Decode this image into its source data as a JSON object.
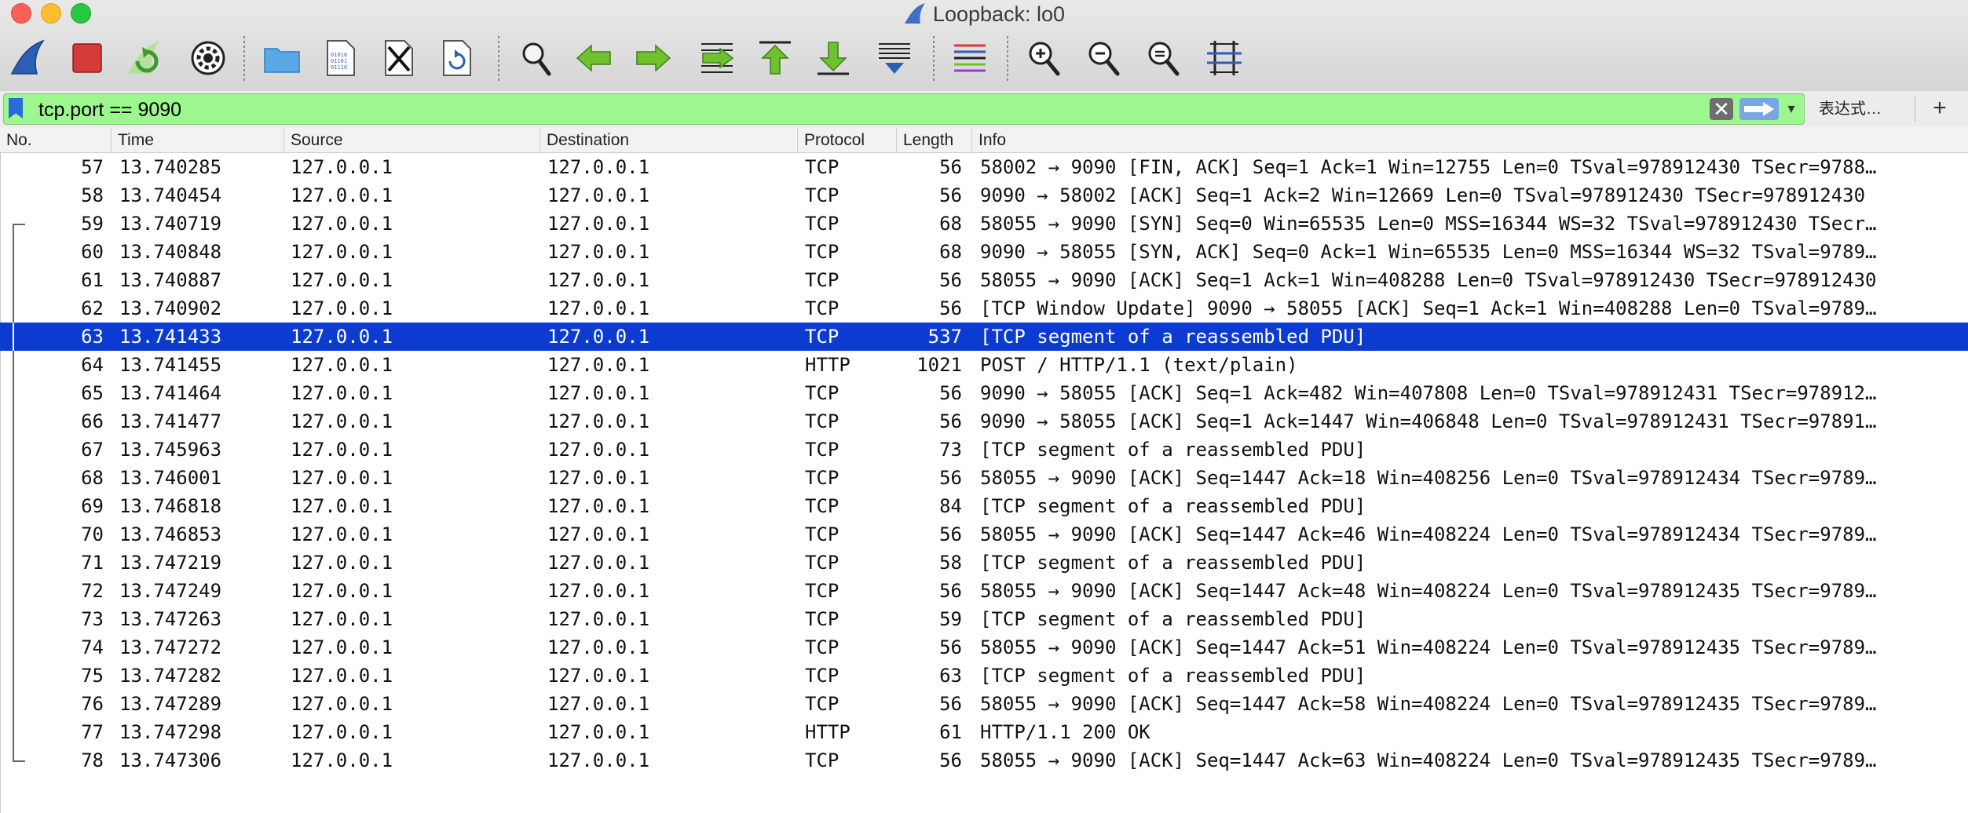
{
  "window": {
    "title": "Loopback: lo0"
  },
  "toolbar": {
    "buttons": [
      {
        "icon": "shark-fin-icon",
        "label": "Start capture"
      },
      {
        "icon": "stop-icon",
        "label": "Stop capture"
      },
      {
        "icon": "restart-icon",
        "label": "Restart capture"
      },
      {
        "icon": "gear-icon",
        "label": "Capture options"
      },
      {
        "icon": "folder-icon",
        "label": "Open"
      },
      {
        "icon": "file-icon",
        "label": "Save"
      },
      {
        "icon": "close-file-icon",
        "label": "Close"
      },
      {
        "icon": "reload-icon",
        "label": "Reload"
      },
      {
        "icon": "search-icon",
        "label": "Find packet"
      },
      {
        "icon": "arrow-left-icon",
        "label": "Previous packet"
      },
      {
        "icon": "arrow-right-icon",
        "label": "Next packet"
      },
      {
        "icon": "goto-icon",
        "label": "Go to packet"
      },
      {
        "icon": "first-packet-icon",
        "label": "First packet"
      },
      {
        "icon": "last-packet-icon",
        "label": "Last packet"
      },
      {
        "icon": "autoscroll-icon",
        "label": "Auto scroll"
      },
      {
        "icon": "colorize-icon",
        "label": "Colorize"
      },
      {
        "icon": "zoom-in-icon",
        "label": "Zoom in"
      },
      {
        "icon": "zoom-out-icon",
        "label": "Zoom out"
      },
      {
        "icon": "zoom-reset-icon",
        "label": "Normal size"
      },
      {
        "icon": "resize-columns-icon",
        "label": "Resize columns"
      }
    ]
  },
  "filter": {
    "value": "tcp.port == 9090",
    "expression_label": "表达式…",
    "add_label": "+"
  },
  "columns": [
    "No.",
    "Time",
    "Source",
    "Destination",
    "Protocol",
    "Length",
    "Info"
  ],
  "packets": [
    {
      "no": "57",
      "time": "13.740285",
      "src": "127.0.0.1",
      "dst": "127.0.0.1",
      "proto": "TCP",
      "len": "56",
      "info": "58002 → 9090 [FIN, ACK] Seq=1 Ack=1 Win=12755 Len=0 TSval=978912430 TSecr=9788…"
    },
    {
      "no": "58",
      "time": "13.740454",
      "src": "127.0.0.1",
      "dst": "127.0.0.1",
      "proto": "TCP",
      "len": "56",
      "info": "9090 → 58002 [ACK] Seq=1 Ack=2 Win=12669 Len=0 TSval=978912430 TSecr=978912430"
    },
    {
      "no": "59",
      "time": "13.740719",
      "src": "127.0.0.1",
      "dst": "127.0.0.1",
      "proto": "TCP",
      "len": "68",
      "info": "58055 → 9090 [SYN] Seq=0 Win=65535 Len=0 MSS=16344 WS=32 TSval=978912430 TSecr…"
    },
    {
      "no": "60",
      "time": "13.740848",
      "src": "127.0.0.1",
      "dst": "127.0.0.1",
      "proto": "TCP",
      "len": "68",
      "info": "9090 → 58055 [SYN, ACK] Seq=0 Ack=1 Win=65535 Len=0 MSS=16344 WS=32 TSval=9789…"
    },
    {
      "no": "61",
      "time": "13.740887",
      "src": "127.0.0.1",
      "dst": "127.0.0.1",
      "proto": "TCP",
      "len": "56",
      "info": "58055 → 9090 [ACK] Seq=1 Ack=1 Win=408288 Len=0 TSval=978912430 TSecr=978912430"
    },
    {
      "no": "62",
      "time": "13.740902",
      "src": "127.0.0.1",
      "dst": "127.0.0.1",
      "proto": "TCP",
      "len": "56",
      "info": "[TCP Window Update] 9090 → 58055 [ACK] Seq=1 Ack=1 Win=408288 Len=0 TSval=9789…"
    },
    {
      "no": "63",
      "time": "13.741433",
      "src": "127.0.0.1",
      "dst": "127.0.0.1",
      "proto": "TCP",
      "len": "537",
      "info": "[TCP segment of a reassembled PDU]",
      "selected": true
    },
    {
      "no": "64",
      "time": "13.741455",
      "src": "127.0.0.1",
      "dst": "127.0.0.1",
      "proto": "HTTP",
      "len": "1021",
      "info": "POST / HTTP/1.1  (text/plain)"
    },
    {
      "no": "65",
      "time": "13.741464",
      "src": "127.0.0.1",
      "dst": "127.0.0.1",
      "proto": "TCP",
      "len": "56",
      "info": "9090 → 58055 [ACK] Seq=1 Ack=482 Win=407808 Len=0 TSval=978912431 TSecr=978912…"
    },
    {
      "no": "66",
      "time": "13.741477",
      "src": "127.0.0.1",
      "dst": "127.0.0.1",
      "proto": "TCP",
      "len": "56",
      "info": "9090 → 58055 [ACK] Seq=1 Ack=1447 Win=406848 Len=0 TSval=978912431 TSecr=97891…"
    },
    {
      "no": "67",
      "time": "13.745963",
      "src": "127.0.0.1",
      "dst": "127.0.0.1",
      "proto": "TCP",
      "len": "73",
      "info": "[TCP segment of a reassembled PDU]"
    },
    {
      "no": "68",
      "time": "13.746001",
      "src": "127.0.0.1",
      "dst": "127.0.0.1",
      "proto": "TCP",
      "len": "56",
      "info": "58055 → 9090 [ACK] Seq=1447 Ack=18 Win=408256 Len=0 TSval=978912434 TSecr=9789…"
    },
    {
      "no": "69",
      "time": "13.746818",
      "src": "127.0.0.1",
      "dst": "127.0.0.1",
      "proto": "TCP",
      "len": "84",
      "info": "[TCP segment of a reassembled PDU]"
    },
    {
      "no": "70",
      "time": "13.746853",
      "src": "127.0.0.1",
      "dst": "127.0.0.1",
      "proto": "TCP",
      "len": "56",
      "info": "58055 → 9090 [ACK] Seq=1447 Ack=46 Win=408224 Len=0 TSval=978912434 TSecr=9789…"
    },
    {
      "no": "71",
      "time": "13.747219",
      "src": "127.0.0.1",
      "dst": "127.0.0.1",
      "proto": "TCP",
      "len": "58",
      "info": "[TCP segment of a reassembled PDU]"
    },
    {
      "no": "72",
      "time": "13.747249",
      "src": "127.0.0.1",
      "dst": "127.0.0.1",
      "proto": "TCP",
      "len": "56",
      "info": "58055 → 9090 [ACK] Seq=1447 Ack=48 Win=408224 Len=0 TSval=978912435 TSecr=9789…"
    },
    {
      "no": "73",
      "time": "13.747263",
      "src": "127.0.0.1",
      "dst": "127.0.0.1",
      "proto": "TCP",
      "len": "59",
      "info": "[TCP segment of a reassembled PDU]"
    },
    {
      "no": "74",
      "time": "13.747272",
      "src": "127.0.0.1",
      "dst": "127.0.0.1",
      "proto": "TCP",
      "len": "56",
      "info": "58055 → 9090 [ACK] Seq=1447 Ack=51 Win=408224 Len=0 TSval=978912435 TSecr=9789…"
    },
    {
      "no": "75",
      "time": "13.747282",
      "src": "127.0.0.1",
      "dst": "127.0.0.1",
      "proto": "TCP",
      "len": "63",
      "info": "[TCP segment of a reassembled PDU]"
    },
    {
      "no": "76",
      "time": "13.747289",
      "src": "127.0.0.1",
      "dst": "127.0.0.1",
      "proto": "TCP",
      "len": "56",
      "info": "58055 → 9090 [ACK] Seq=1447 Ack=58 Win=408224 Len=0 TSval=978912435 TSecr=9789…"
    },
    {
      "no": "77",
      "time": "13.747298",
      "src": "127.0.0.1",
      "dst": "127.0.0.1",
      "proto": "HTTP",
      "len": "61",
      "info": "HTTP/1.1 200 OK"
    },
    {
      "no": "78",
      "time": "13.747306",
      "src": "127.0.0.1",
      "dst": "127.0.0.1",
      "proto": "TCP",
      "len": "56",
      "info": "58055 → 9090 [ACK] Seq=1447 Ack=63 Win=408224 Len=0 TSval=978912435 TSecr=9789…"
    }
  ],
  "colors": {
    "filter_valid": "#9cf78e",
    "selected_row": "#0c3bd1",
    "toolbar_green": "#6fc12f",
    "shark_blue": "#2a5fb3",
    "stop_red": "#d43a3a"
  }
}
